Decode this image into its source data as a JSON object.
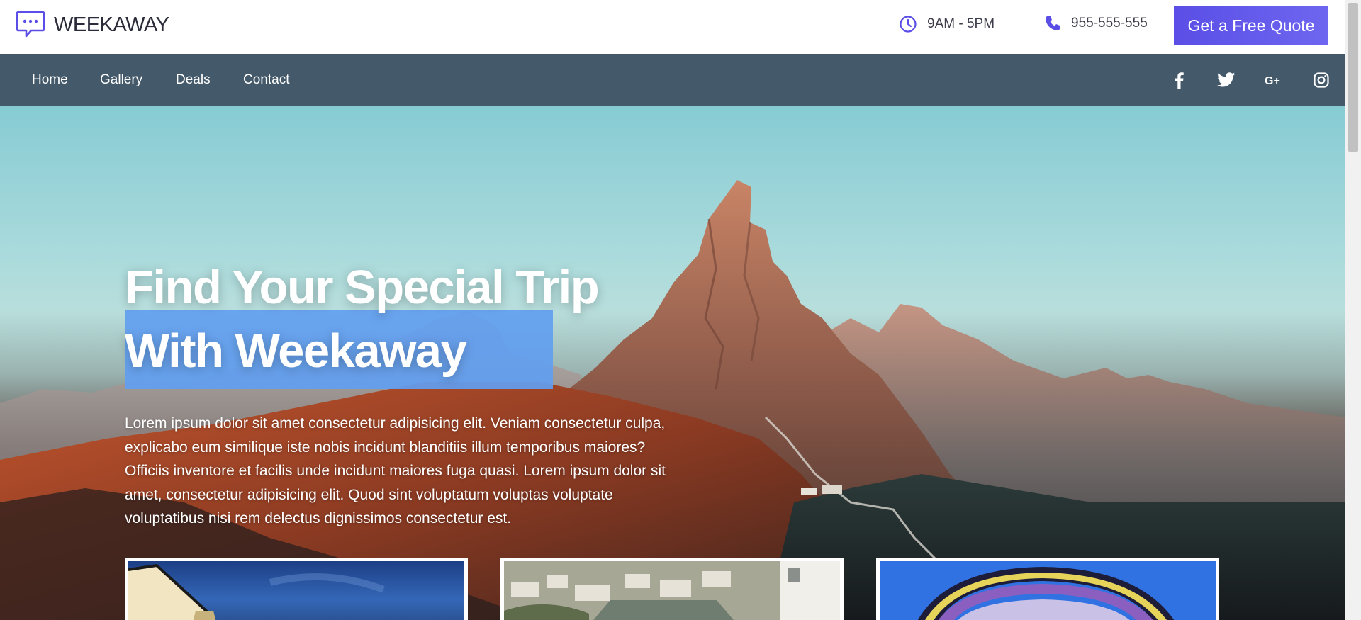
{
  "brand": {
    "name": "WEEKAWAY",
    "icon": "chat-bubble-icon",
    "accent": "#5a4ee6"
  },
  "header": {
    "hours": {
      "icon": "clock-icon",
      "text": "9AM - 5PM"
    },
    "phone": {
      "icon": "phone-icon",
      "text": "955-555-555"
    },
    "cta_label": "Get a Free Quote"
  },
  "nav": {
    "items": [
      {
        "label": "Home"
      },
      {
        "label": "Gallery"
      },
      {
        "label": "Deals"
      },
      {
        "label": "Contact"
      }
    ],
    "social": [
      {
        "icon": "facebook-icon"
      },
      {
        "icon": "twitter-icon"
      },
      {
        "icon": "google-plus-icon"
      },
      {
        "icon": "instagram-icon"
      }
    ],
    "background": "#44596a"
  },
  "hero": {
    "title_line1": "Find Your Special Trip",
    "title_line2": "With Weekaway",
    "highlight_color": "#629ef0",
    "description": "Lorem ipsum dolor sit amet consectetur adipisicing elit. Veniam consectetur culpa, explicabo eum similique iste nobis incidunt blanditiis illum temporibus maiores? Officiis inventore et facilis unde incidunt maiores fuga quasi. Lorem ipsum dolor sit amet, consectetur adipisicing elit. Quod sint voluptatum voluptas voluptate voluptatibus nisi rem delectus dignissimos consectetur est."
  },
  "cards": [
    {
      "image": "night-building-photo"
    },
    {
      "image": "hillside-town-photo"
    },
    {
      "image": "paraglider-photo"
    }
  ]
}
